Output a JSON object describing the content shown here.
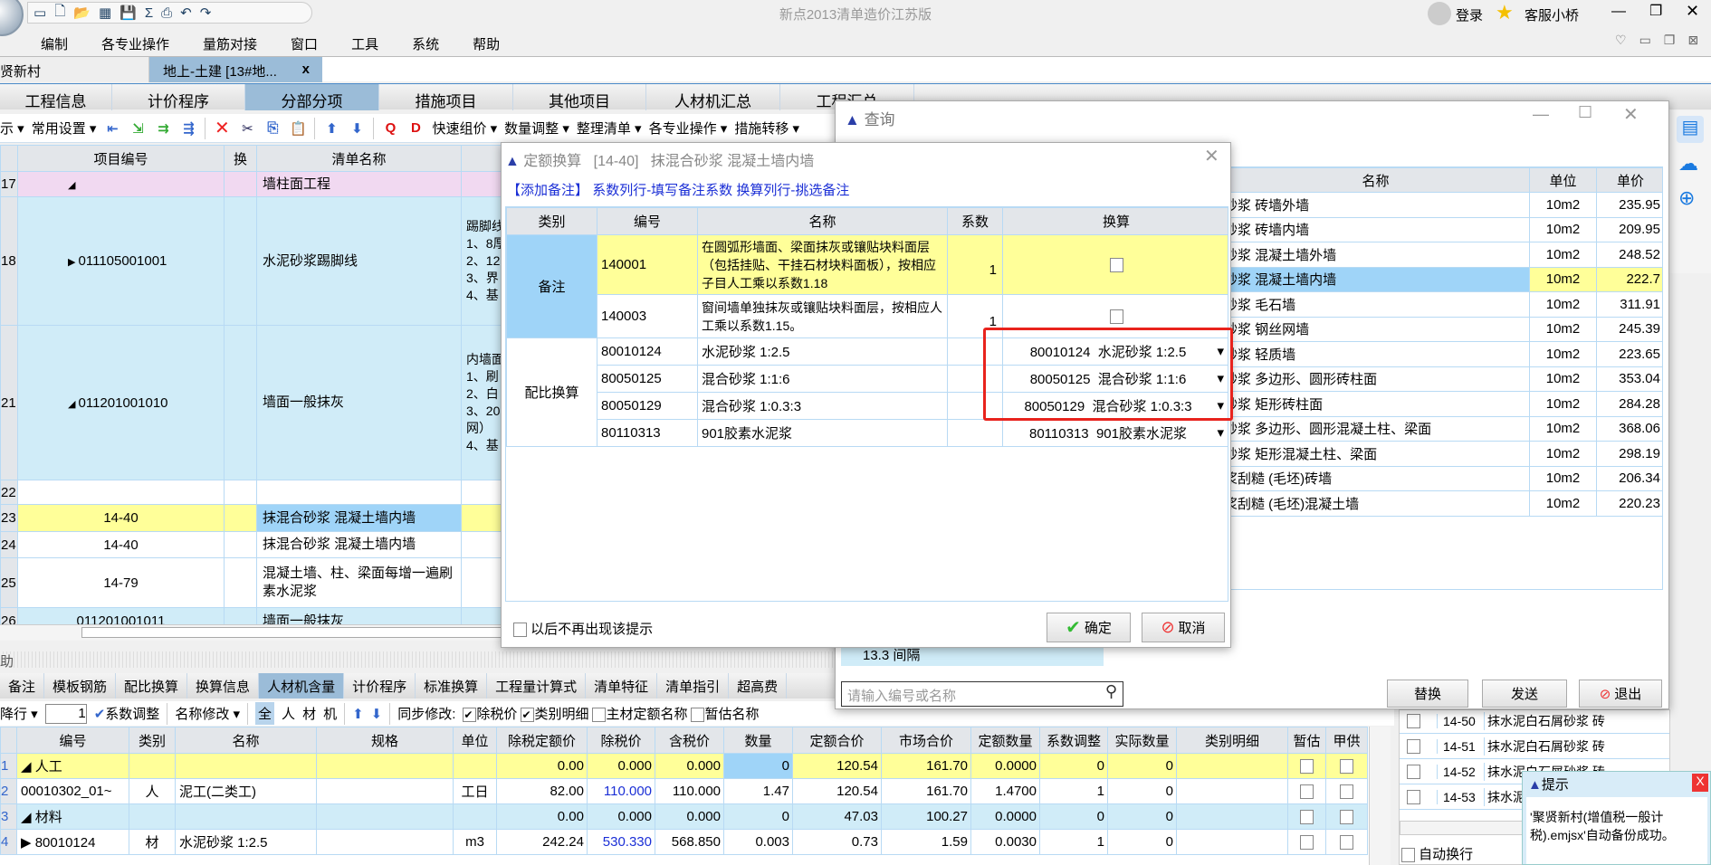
{
  "app": {
    "title": "新点2013清单造价江苏版",
    "quick_access_icons": [
      "new-icon",
      "file-icon",
      "open-folder-icon",
      "save-as-icon",
      "save-icon",
      "sigma-icon",
      "print-icon",
      "undo-icon",
      "redo-icon"
    ],
    "login": "登录",
    "customer_service": "客服小桥",
    "menu": [
      "编制",
      "各专业操作",
      "量筋对接",
      "窗口",
      "工具",
      "系统",
      "帮助"
    ]
  },
  "doc_tabs": [
    {
      "label": "贤新村"
    },
    {
      "label": "地上-土建 [13#地...",
      "close": "x"
    }
  ],
  "main_tabs": [
    "工程信息",
    "计价程序",
    "分部分项",
    "措施项目",
    "其他项目",
    "人材机汇总",
    "工程汇总"
  ],
  "main_tabs_active": 2,
  "toolbar": {
    "items": [
      "示",
      "常用设置",
      "快速组价",
      "数量调整",
      "整理清单",
      "各专业操作",
      "措施转移"
    ]
  },
  "upper_grid": {
    "headers": [
      "",
      "项目编号",
      "换",
      "清单名称",
      ""
    ],
    "rows": [
      {
        "num": "17",
        "code": "",
        "expander": "◢",
        "name": "墙柱面工程",
        "feature": "",
        "style": "group"
      },
      {
        "num": "18",
        "code": "011105001001",
        "expander": "▶",
        "name": "水泥砂浆踢脚线",
        "feature": "踢脚线\n1、8厚\n2、12\n3、界\n4、基",
        "style": "item"
      },
      {
        "num": "21",
        "code": "011201001010",
        "expander": "◢",
        "name": "墙面一般抹灰",
        "feature": "内墙面\n1、刷\n2、白\n3、20\n网）\n4、基",
        "style": "item"
      },
      {
        "num": "22",
        "code": "",
        "expander": "",
        "name": "",
        "feature": "",
        "style": "plain"
      },
      {
        "num": "23",
        "code": "14-40",
        "expander": "",
        "name": "抹混合砂浆 混凝土墙内墙",
        "feature": "",
        "style": "selected"
      },
      {
        "num": "24",
        "code": "14-40",
        "expander": "",
        "name": "抹混合砂浆 混凝土墙内墙",
        "feature": "",
        "style": "plain"
      },
      {
        "num": "25",
        "code": "14-79",
        "expander": "",
        "name": "混凝土墙、柱、梁面每增一遍刷素水泥浆",
        "feature": "",
        "style": "plain"
      },
      {
        "num": "26",
        "code": "011201001011",
        "expander": "",
        "name": "墙面一般抹灰",
        "feature": "",
        "style": "item"
      }
    ]
  },
  "splitter_label": "助",
  "bottom_tabs": [
    "备注",
    "模板钢筋",
    "配比换算",
    "换算信息",
    "人材机含量",
    "计价程序",
    "标准换算",
    "工程量计算式",
    "清单特征",
    "清单指引",
    "超高费"
  ],
  "bottom_tabs_active": 4,
  "bottom_toolbar": {
    "row_mode": "降行",
    "row_value": "1",
    "coef_adjust": "系数调整",
    "name_modify": "名称修改",
    "filters": [
      "全",
      "人",
      "材",
      "机"
    ],
    "sync_label": "同步修改:",
    "sync_options": [
      {
        "label": "除税价",
        "checked": true
      },
      {
        "label": "类别明细",
        "checked": true
      },
      {
        "label": "主材定额名称",
        "checked": false
      },
      {
        "label": "暂估名称",
        "checked": false
      }
    ]
  },
  "bottom_grid": {
    "headers": [
      "",
      "编号",
      "类别",
      "名称",
      "规格",
      "单位",
      "除税定额价",
      "除税价",
      "含税价",
      "数量",
      "定额合价",
      "市场合价",
      "定额数量",
      "系数调整",
      "实际数量",
      "类别明细",
      "暂估",
      "甲供"
    ],
    "rows": [
      {
        "num": "1",
        "cells": [
          "◢ 人工",
          "",
          "",
          "",
          "",
          "0.00",
          "0.000",
          "0.000",
          "0",
          "120.54",
          "161.70",
          "0.0000",
          "0",
          "0",
          ""
        ],
        "style": "yellow"
      },
      {
        "num": "2",
        "cells": [
          "00010302_01~",
          "人",
          "泥工(二类工)",
          "",
          "工日",
          "82.00",
          "110.000",
          "110.000",
          "1.47",
          "120.54",
          "161.70",
          "1.4700",
          "1",
          "0",
          ""
        ],
        "style": "plain"
      },
      {
        "num": "3",
        "cells": [
          "◢ 材料",
          "",
          "",
          "",
          "",
          "0.00",
          "0.000",
          "0.000",
          "0",
          "47.03",
          "100.27",
          "0.0000",
          "0",
          "0",
          ""
        ],
        "style": "blue"
      },
      {
        "num": "4",
        "cells": [
          "▶ 80010124",
          "材",
          "水泥砂浆 1:2.5",
          "",
          "m3",
          "242.24",
          "530.330",
          "568.850",
          "0.003",
          "0.73",
          "1.59",
          "0.0030",
          "1",
          "0",
          ""
        ],
        "style": "plain"
      }
    ]
  },
  "query_window": {
    "title": "查询",
    "headers": [
      "名称",
      "单位",
      "单价"
    ],
    "rows": [
      {
        "name": "砂浆 砖墙外墙",
        "unit": "10m2",
        "price": "235.95"
      },
      {
        "name": "砂浆 砖墙内墙",
        "unit": "10m2",
        "price": "209.95"
      },
      {
        "name": "砂浆 混凝土墙外墙",
        "unit": "10m2",
        "price": "248.52"
      },
      {
        "name": "砂浆 混凝土墙内墙",
        "unit": "10m2",
        "price": "222.7",
        "selected": true
      },
      {
        "name": "砂浆 毛石墙",
        "unit": "10m2",
        "price": "311.91"
      },
      {
        "name": "砂浆 钢丝网墙",
        "unit": "10m2",
        "price": "245.39"
      },
      {
        "name": "砂浆 轻质墙",
        "unit": "10m2",
        "price": "223.65"
      },
      {
        "name": "砂浆 多边形、圆形砖柱面",
        "unit": "10m2",
        "price": "353.04"
      },
      {
        "name": "砂浆 矩形砖柱面",
        "unit": "10m2",
        "price": "284.28"
      },
      {
        "name": "砂浆 多边形、圆形混凝土柱、梁面",
        "unit": "10m2",
        "price": "368.06"
      },
      {
        "name": "砂浆 矩形混凝土柱、梁面",
        "unit": "10m2",
        "price": "298.19"
      },
      {
        "name": "浆刮糙 (毛坯)砖墙",
        "unit": "10m2",
        "price": "206.34"
      },
      {
        "name": "浆刮糙 (毛坯)混凝土墙",
        "unit": "10m2",
        "price": "220.23"
      }
    ],
    "tree_item": "13.3 间隔",
    "search_placeholder": "请输入编号或名称",
    "replace": "替换",
    "send": "发送",
    "exit": "退出"
  },
  "dialog": {
    "title": "定额换算   [14-40]   抹混合砂浆 混凝土墙内墙",
    "hint_add": "【添加备注】",
    "hint_coef": "系数列行-填写备注系数",
    "hint_conv": "换算列行-挑选备注",
    "headers": [
      "类别",
      "编号",
      "名称",
      "系数",
      "换算"
    ],
    "group_note": "备注",
    "group_mix": "配比换算",
    "notes": [
      {
        "code": "140001",
        "name": "在圆弧形墙面、梁面抹灰或镶贴块料面层（包括挂贴、干挂石材块料面板），按相应子目人工乘以系数1.18",
        "coef": "1",
        "checked": false
      },
      {
        "code": "140003",
        "name": "窗间墙单独抹灰或镶贴块料面层，按相应人工乘以系数1.15。",
        "coef": "1",
        "checked": false
      }
    ],
    "mixes": [
      {
        "code": "80010124",
        "name": "水泥砂浆 1:2.5",
        "selected": "80010124  水泥砂浆 1:2.5"
      },
      {
        "code": "80050125",
        "name": "混合砂浆 1:1:6",
        "selected": "80050125  混合砂浆 1:1:6"
      },
      {
        "code": "80050129",
        "name": "混合砂浆 1:0.3:3",
        "selected": "80050129  混合砂浆 1:0.3:3"
      },
      {
        "code": "80110313",
        "name": "901胶素水泥浆",
        "selected": "80110313  901胶素水泥浆"
      }
    ],
    "dont_show": "以后不再出现该提示",
    "ok": "确定",
    "cancel": "取消",
    "highlight_color": "#e8231d"
  },
  "right_list": {
    "rows": [
      {
        "code": "14-50",
        "name": "抹水泥白石屑砂浆 砖"
      },
      {
        "code": "14-51",
        "name": "抹水泥白石屑砂浆 砖"
      },
      {
        "code": "14-52",
        "name": "抹水泥白石屑砂浆 砖"
      },
      {
        "code": "14-53",
        "name": "抹水泥白石屑砂浆 砖"
      }
    ],
    "auto_wrap": "自动换行"
  },
  "toast": {
    "title": "提示",
    "close": "X",
    "message": "'聚贤新村(增值税一般计税).emjsx'自动备份成功。"
  },
  "colors": {
    "yellow_row": "#ffff99",
    "blue_row": "#d0ecf8",
    "selected_cell": "#9fd4f8",
    "group_row": "#f1d9f1",
    "active_tab": "#9bbcd8",
    "link": "#1b2fd6"
  }
}
